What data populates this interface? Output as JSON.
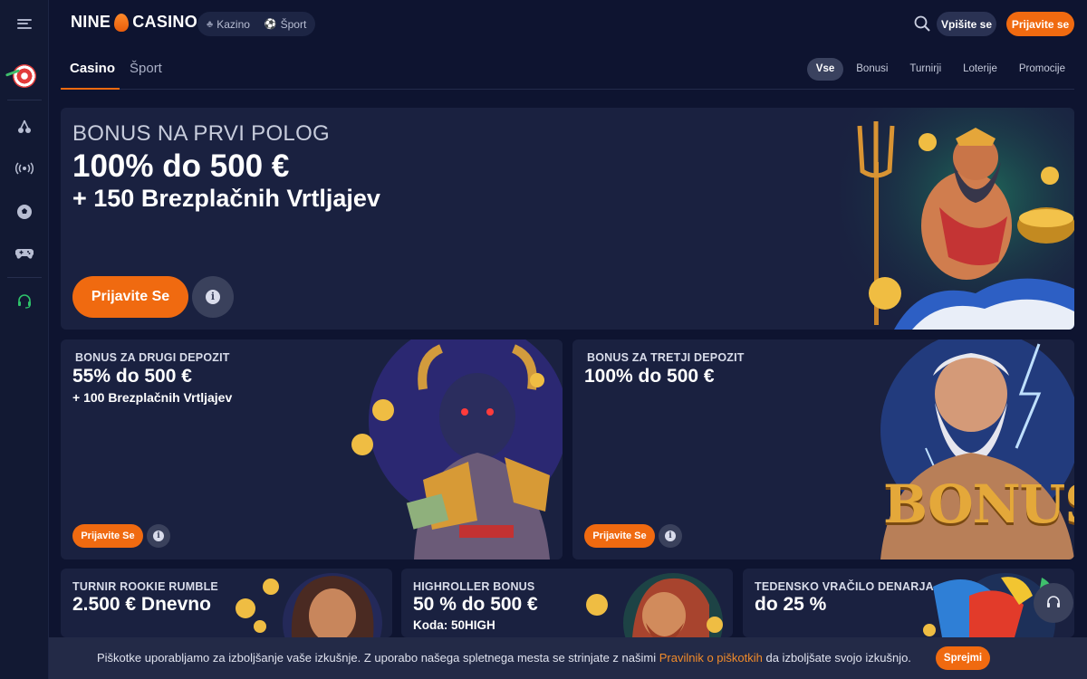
{
  "brand": {
    "logo_left": "NINE",
    "logo_right": "CASINO",
    "accent": "#f06a10",
    "background": "#0e1430",
    "card_background": "#1a2140"
  },
  "rail": {
    "items": [
      {
        "icon": "dart-target-icon"
      },
      {
        "icon": "cherries-icon"
      },
      {
        "icon": "live-broadcast-icon"
      },
      {
        "icon": "soccer-ball-icon"
      },
      {
        "icon": "gamepad-icon"
      },
      {
        "icon": "headset-support-icon"
      }
    ]
  },
  "header": {
    "nav": [
      {
        "label": "Kazino",
        "icon": "cherries-icon"
      },
      {
        "label": "Šport",
        "icon": "soccer-ball-icon"
      }
    ],
    "login_label": "Vpišite se",
    "register_label": "Prijavite se"
  },
  "subnav": {
    "tabs": [
      {
        "label": "Casino",
        "active": true
      },
      {
        "label": "Šport",
        "active": false
      }
    ],
    "filters": [
      {
        "label": "Vse",
        "active": true
      },
      {
        "label": "Bonusi",
        "active": false
      },
      {
        "label": "Turnirji",
        "active": false
      },
      {
        "label": "Loterije",
        "active": false
      },
      {
        "label": "Promocije",
        "active": false
      }
    ]
  },
  "hero": {
    "kicker": "BONUS NA PRVI POLOG",
    "headline": "100% do 500 €",
    "sub": "+ 150 Brezplačnih Vrtljajev",
    "cta": "Prijavite Se",
    "info": "i"
  },
  "cards": [
    {
      "kicker": "BONUS ZA DRUGI DEPOZIT",
      "headline": "55% do 500 €",
      "sub": "+ 100 Brezplačnih Vrtljajev",
      "cta": "Prijavite Se",
      "info": "i"
    },
    {
      "kicker": "BONUS ZA TRETJI DEPOZIT",
      "headline": "100% do 500 €",
      "art_text": "BONUS",
      "cta": "Prijavite Se",
      "info": "i"
    }
  ],
  "small_cards": [
    {
      "kicker": "TURNIR ROOKIE RUMBLE",
      "headline": "2.500 € Dnevno"
    },
    {
      "kicker": "HIGHROLLER BONUS",
      "headline": "50 % do 500 €",
      "sub": "Koda: 50HIGH"
    },
    {
      "kicker": "TEDENSKO VRAČILO DENARJA",
      "headline": "do 25 %"
    }
  ],
  "cookie": {
    "text_before": "Piškotke uporabljamo za izboljšanje vaše izkušnje. Z uporabo našega spletnega mesta se strinjate z našimi ",
    "link": "Pravilnik o piškotkih",
    "text_after": " da izboljšate svojo izkušnjo.",
    "accept": "Sprejmi"
  }
}
